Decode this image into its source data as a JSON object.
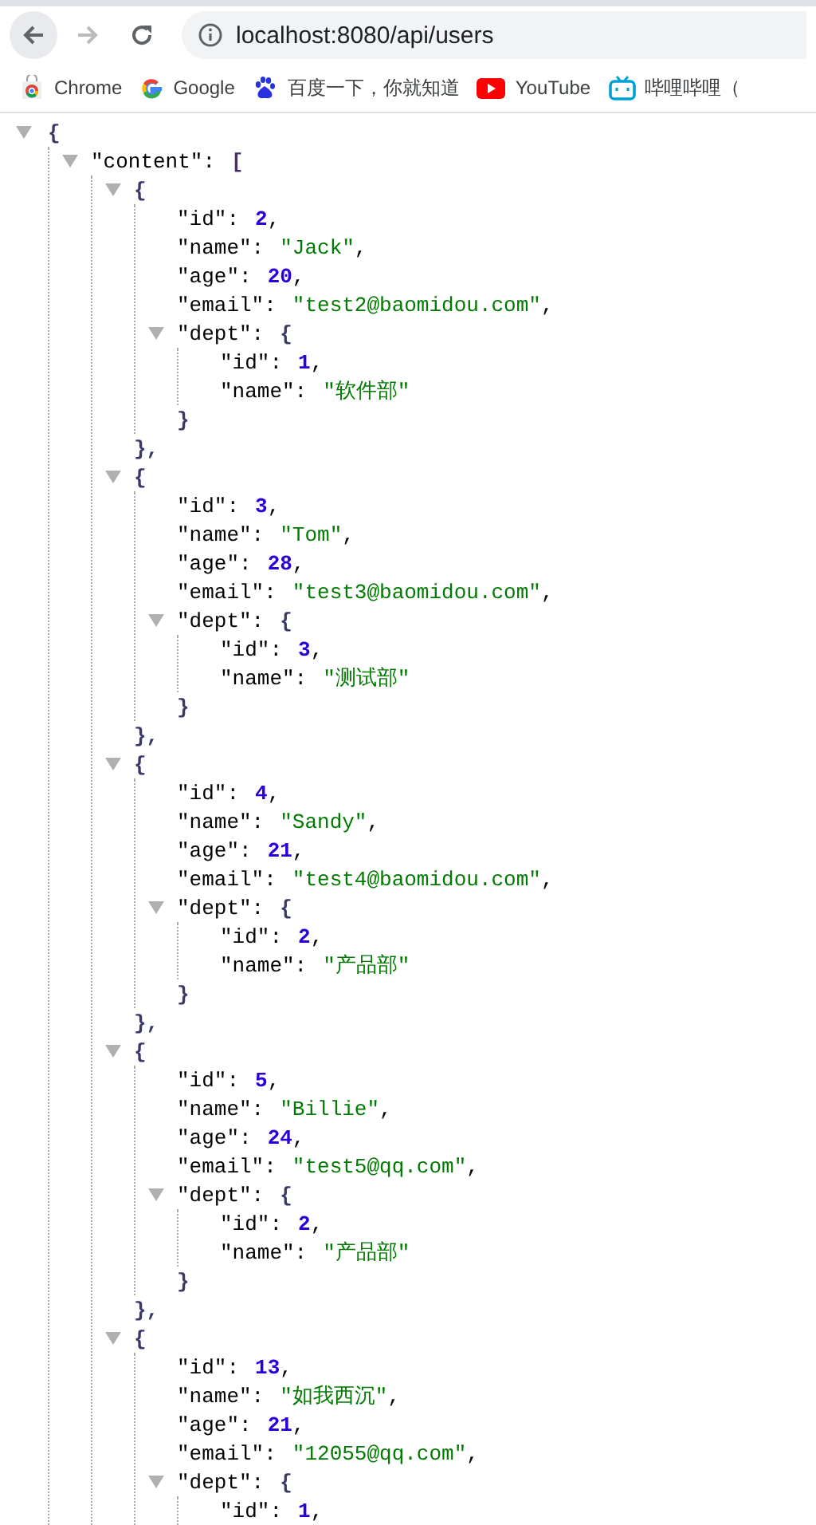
{
  "browser": {
    "url": "localhost:8080/api/users",
    "back_disabled": false,
    "forward_disabled": true
  },
  "bookmarks": [
    {
      "label": "Chrome",
      "kind": "webstore"
    },
    {
      "label": "Google",
      "kind": "google"
    },
    {
      "label": "百度一下，你就知道",
      "kind": "baidu"
    },
    {
      "label": "YouTube",
      "kind": "youtube"
    },
    {
      "label": "哔哩哔哩（",
      "kind": "bilibili"
    }
  ],
  "json_viewer": {
    "root": {
      "kind": "object",
      "open": "{",
      "expanded": true,
      "children": [
        {
          "kind": "array",
          "key": "\"content\":",
          "open": "[",
          "expanded": true,
          "children": [
            {
              "kind": "object",
              "open": "{",
              "expanded": true,
              "close": "},",
              "children": [
                {
                  "kind": "number",
                  "key": "\"id\":",
                  "value": "2",
                  "punct": ","
                },
                {
                  "kind": "string",
                  "key": "\"name\":",
                  "value": "\"Jack\"",
                  "punct": ","
                },
                {
                  "kind": "number",
                  "key": "\"age\":",
                  "value": "20",
                  "punct": ","
                },
                {
                  "kind": "string",
                  "key": "\"email\":",
                  "value": "\"test2@baomidou.com\"",
                  "punct": ","
                },
                {
                  "kind": "object",
                  "key": "\"dept\":",
                  "open": "{",
                  "expanded": true,
                  "close": "}",
                  "children": [
                    {
                      "kind": "number",
                      "key": "\"id\":",
                      "value": "1",
                      "punct": ","
                    },
                    {
                      "kind": "string",
                      "key": "\"name\":",
                      "value": "\"软件部\""
                    }
                  ]
                }
              ]
            },
            {
              "kind": "object",
              "open": "{",
              "expanded": true,
              "close": "},",
              "children": [
                {
                  "kind": "number",
                  "key": "\"id\":",
                  "value": "3",
                  "punct": ","
                },
                {
                  "kind": "string",
                  "key": "\"name\":",
                  "value": "\"Tom\"",
                  "punct": ","
                },
                {
                  "kind": "number",
                  "key": "\"age\":",
                  "value": "28",
                  "punct": ","
                },
                {
                  "kind": "string",
                  "key": "\"email\":",
                  "value": "\"test3@baomidou.com\"",
                  "punct": ","
                },
                {
                  "kind": "object",
                  "key": "\"dept\":",
                  "open": "{",
                  "expanded": true,
                  "close": "}",
                  "children": [
                    {
                      "kind": "number",
                      "key": "\"id\":",
                      "value": "3",
                      "punct": ","
                    },
                    {
                      "kind": "string",
                      "key": "\"name\":",
                      "value": "\"测试部\""
                    }
                  ]
                }
              ]
            },
            {
              "kind": "object",
              "open": "{",
              "expanded": true,
              "close": "},",
              "children": [
                {
                  "kind": "number",
                  "key": "\"id\":",
                  "value": "4",
                  "punct": ","
                },
                {
                  "kind": "string",
                  "key": "\"name\":",
                  "value": "\"Sandy\"",
                  "punct": ","
                },
                {
                  "kind": "number",
                  "key": "\"age\":",
                  "value": "21",
                  "punct": ","
                },
                {
                  "kind": "string",
                  "key": "\"email\":",
                  "value": "\"test4@baomidou.com\"",
                  "punct": ","
                },
                {
                  "kind": "object",
                  "key": "\"dept\":",
                  "open": "{",
                  "expanded": true,
                  "close": "}",
                  "children": [
                    {
                      "kind": "number",
                      "key": "\"id\":",
                      "value": "2",
                      "punct": ","
                    },
                    {
                      "kind": "string",
                      "key": "\"name\":",
                      "value": "\"产品部\""
                    }
                  ]
                }
              ]
            },
            {
              "kind": "object",
              "open": "{",
              "expanded": true,
              "close": "},",
              "children": [
                {
                  "kind": "number",
                  "key": "\"id\":",
                  "value": "5",
                  "punct": ","
                },
                {
                  "kind": "string",
                  "key": "\"name\":",
                  "value": "\"Billie\"",
                  "punct": ","
                },
                {
                  "kind": "number",
                  "key": "\"age\":",
                  "value": "24",
                  "punct": ","
                },
                {
                  "kind": "string",
                  "key": "\"email\":",
                  "value": "\"test5@qq.com\"",
                  "punct": ","
                },
                {
                  "kind": "object",
                  "key": "\"dept\":",
                  "open": "{",
                  "expanded": true,
                  "close": "}",
                  "children": [
                    {
                      "kind": "number",
                      "key": "\"id\":",
                      "value": "2",
                      "punct": ","
                    },
                    {
                      "kind": "string",
                      "key": "\"name\":",
                      "value": "\"产品部\""
                    }
                  ]
                }
              ]
            },
            {
              "kind": "object",
              "open": "{",
              "expanded": true,
              "children": [
                {
                  "kind": "number",
                  "key": "\"id\":",
                  "value": "13",
                  "punct": ","
                },
                {
                  "kind": "string",
                  "key": "\"name\":",
                  "value": "\"如我西沉\"",
                  "punct": ","
                },
                {
                  "kind": "number",
                  "key": "\"age\":",
                  "value": "21",
                  "punct": ","
                },
                {
                  "kind": "string",
                  "key": "\"email\":",
                  "value": "\"12055@qq.com\"",
                  "punct": ","
                },
                {
                  "kind": "object",
                  "key": "\"dept\":",
                  "open": "{",
                  "expanded": true,
                  "children": [
                    {
                      "kind": "number",
                      "key": "\"id\":",
                      "value": "1",
                      "punct": ","
                    }
                  ]
                }
              ]
            }
          ]
        }
      ]
    }
  }
}
